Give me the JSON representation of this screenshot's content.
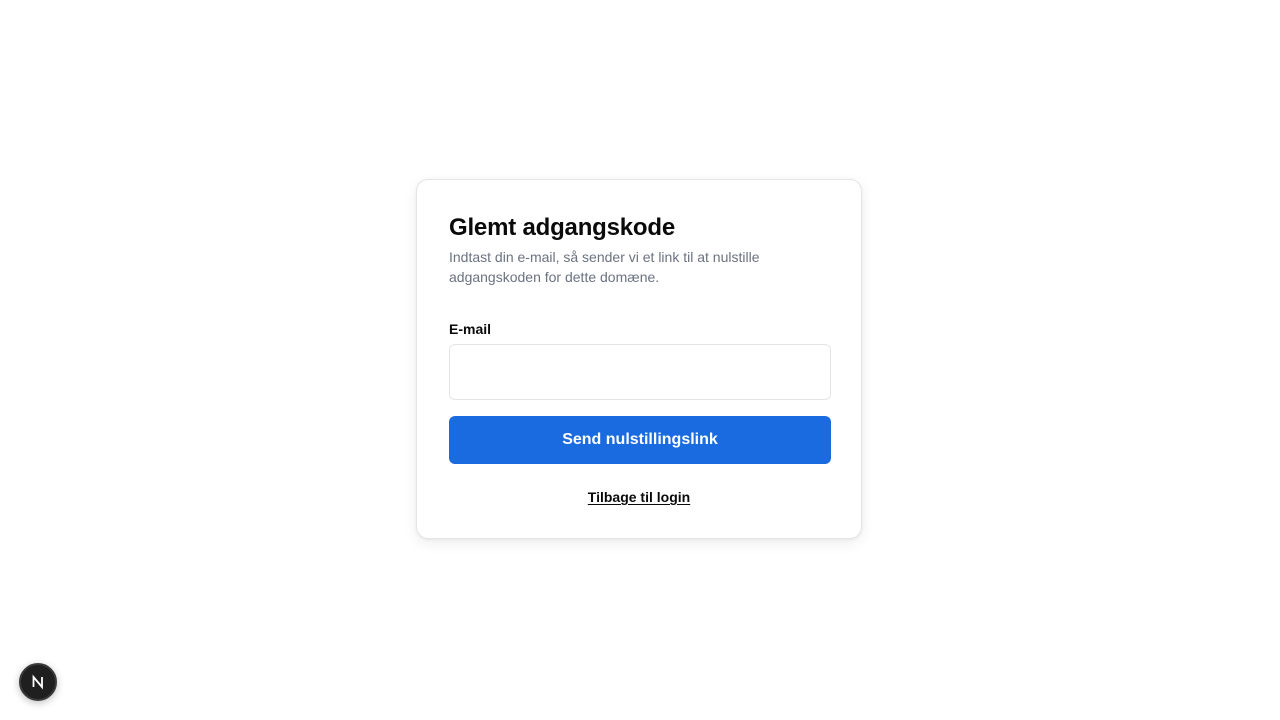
{
  "card": {
    "title": "Glemt adgangskode",
    "subtitle": "Indtast din e-mail, så sender vi et link til at nulstille adgangskoden for dette domæne."
  },
  "form": {
    "email_label": "E-mail",
    "email_value": "",
    "email_placeholder": "",
    "submit_label": "Send nulstillingslink",
    "back_link_label": "Tilbage til login"
  },
  "dev_badge": {
    "icon": "nextjs-logo-icon"
  },
  "colors": {
    "primary_button": "#1a6ae0",
    "subtitle_text": "#6b7280",
    "card_border": "#e4e4e7",
    "badge_background": "#1f1f1f"
  }
}
